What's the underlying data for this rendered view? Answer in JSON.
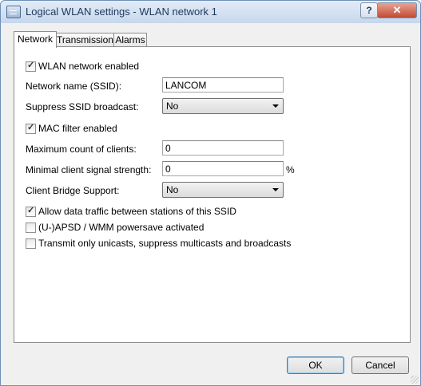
{
  "window": {
    "title": "Logical WLAN settings - WLAN network 1",
    "help_label": "?",
    "close_label": "✕"
  },
  "tabs": [
    {
      "label": "Network"
    },
    {
      "label": "Transmission"
    },
    {
      "label": "Alarms"
    }
  ],
  "network": {
    "wlan_enabled": {
      "label": "WLAN network enabled",
      "checked": true
    },
    "ssid": {
      "label": "Network name (SSID):",
      "value": "LANCOM"
    },
    "suppress_ssid": {
      "label": "Suppress SSID broadcast:",
      "value": "No"
    },
    "mac_filter": {
      "label": "MAC filter enabled",
      "checked": true
    },
    "max_clients": {
      "label": "Maximum count of clients:",
      "value": "0"
    },
    "min_signal": {
      "label": "Minimal client signal strength:",
      "value": "0",
      "unit": "%"
    },
    "client_bridge": {
      "label": "Client Bridge Support:",
      "value": "No"
    },
    "allow_traffic": {
      "label": "Allow data traffic between stations of this SSID",
      "checked": true
    },
    "apsd": {
      "label": "(U-)APSD / WMM powersave activated",
      "checked": false
    },
    "unicast_only": {
      "label": "Transmit only unicasts, suppress multicasts and broadcasts",
      "checked": false
    }
  },
  "buttons": {
    "ok": "OK",
    "cancel": "Cancel"
  }
}
